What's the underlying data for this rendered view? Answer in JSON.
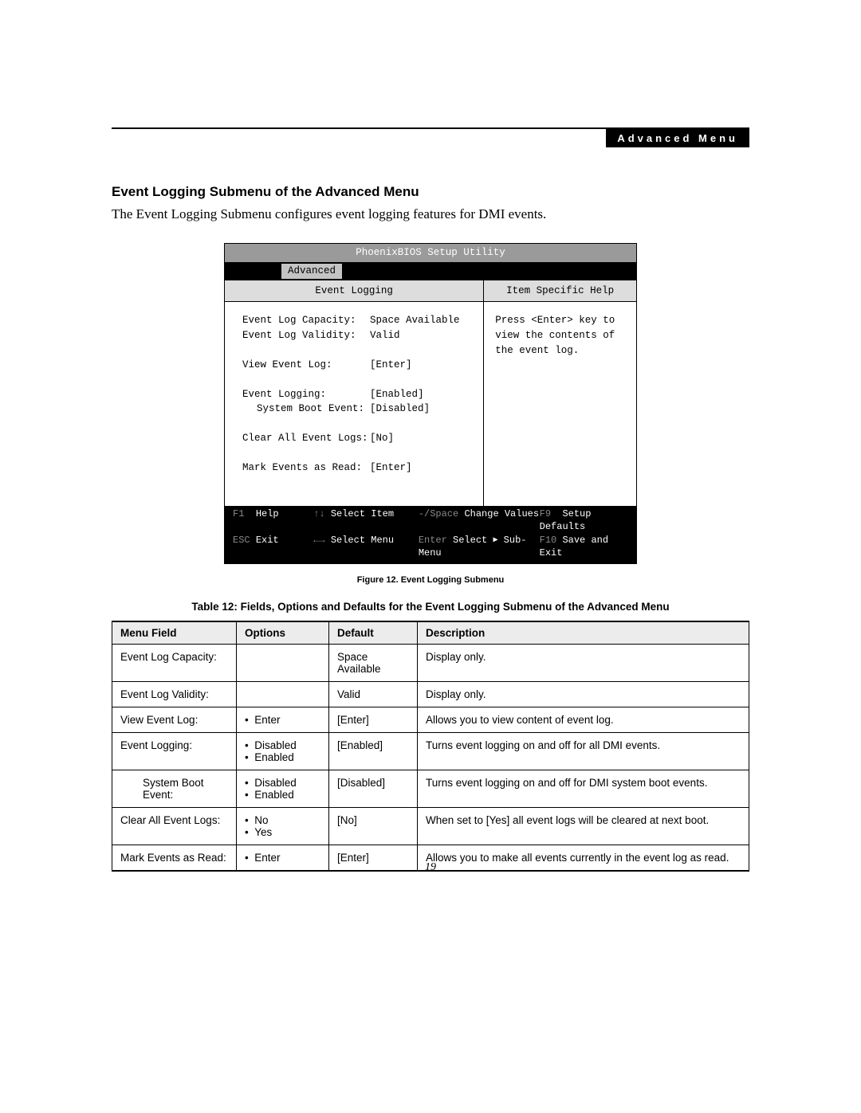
{
  "header": {
    "tag": "Advanced Menu"
  },
  "section": {
    "heading": "Event Logging Submenu of the Advanced Menu",
    "intro": "The Event Logging Submenu configures event logging features for DMI events."
  },
  "bios": {
    "title": "PhoenixBIOS Setup Utility",
    "tab": "Advanced",
    "left_heading": "Event Logging",
    "right_heading": "Item Specific Help",
    "rows": [
      {
        "k": "Event Log Capacity:",
        "v": "Space Available"
      },
      {
        "k": "Event Log Validity:",
        "v": "Valid"
      },
      {
        "spacer": true
      },
      {
        "k": "View Event Log:",
        "v": "[Enter]"
      },
      {
        "spacer": true
      },
      {
        "k": "Event Logging:",
        "v": "[Enabled]"
      },
      {
        "k": "System Boot Event:",
        "v": "[Disabled]",
        "indent": true
      },
      {
        "spacer": true
      },
      {
        "k": "Clear All Event Logs:",
        "v": "[No]"
      },
      {
        "spacer": true
      },
      {
        "k": "Mark Events as Read:",
        "v": "[Enter]"
      }
    ],
    "help_text": "Press <Enter> key to view the contents of the event log.",
    "footer": {
      "f1": "F1",
      "f1_l": "Help",
      "esc": "ESC",
      "esc_l": "Exit",
      "ud": "↑↓",
      "ud_l": "Select Item",
      "lr": "←→",
      "lr_l": "Select Menu",
      "sp": "-/Space",
      "sp_l": "Change Values",
      "en": "Enter",
      "en_l": "Select ▶ Sub-Menu",
      "f9": "F9",
      "f9_l": "Setup Defaults",
      "f10": "F10",
      "f10_l": "Save and Exit"
    }
  },
  "figure_caption": "Figure 12.   Event Logging Submenu",
  "table_caption": "Table 12: Fields, Options and Defaults for the Event Logging Submenu of the Advanced Menu",
  "table": {
    "headers": [
      "Menu Field",
      "Options",
      "Default",
      "Description"
    ],
    "rows": [
      {
        "field": "Event Log Capacity:",
        "options": [],
        "default": "Space Available",
        "desc": "Display only."
      },
      {
        "field": "Event Log Validity:",
        "options": [],
        "default": "Valid",
        "desc": "Display only."
      },
      {
        "field": "View Event Log:",
        "options": [
          "Enter"
        ],
        "default": "[Enter]",
        "desc": "Allows you to view content of event log."
      },
      {
        "field": "Event Logging:",
        "options": [
          "Disabled",
          "Enabled"
        ],
        "default": "[Enabled]",
        "desc": "Turns event logging on and off for all DMI events."
      },
      {
        "field": "System Boot Event:",
        "indent": true,
        "options": [
          "Disabled",
          "Enabled"
        ],
        "default": "[Disabled]",
        "desc": "Turns event logging on and off for DMI system boot events."
      },
      {
        "field": "Clear All Event Logs:",
        "options": [
          "No",
          "Yes"
        ],
        "default": "[No]",
        "desc": "When set to [Yes] all event logs will be cleared at next boot."
      },
      {
        "field": "Mark Events as Read:",
        "options": [
          "Enter"
        ],
        "default": "[Enter]",
        "desc": "Allows you to make all events currently in the event log as read."
      }
    ]
  },
  "page_number": "19"
}
